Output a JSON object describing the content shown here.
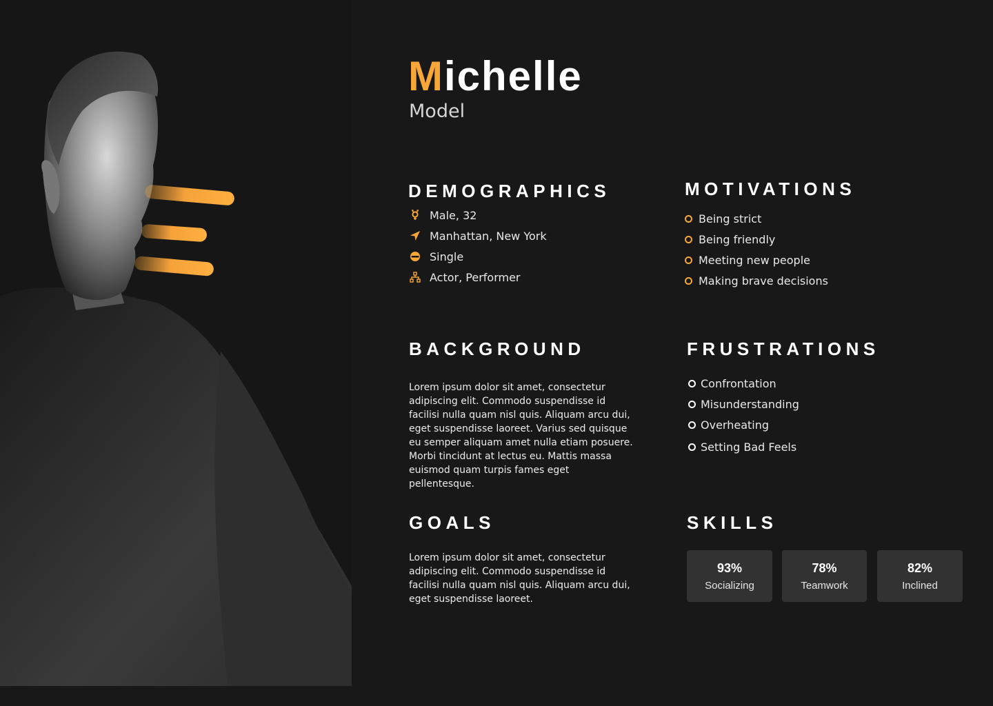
{
  "persona": {
    "name_initial": "M",
    "name_rest": "ichelle",
    "role": "Model"
  },
  "colors": {
    "accent": "#f7a738",
    "background": "#181818",
    "card": "#323232"
  },
  "demographics": {
    "title": "DEMOGRAPHICS",
    "items": [
      {
        "icon": "gender-icon",
        "text": "Male, 32"
      },
      {
        "icon": "location-arrow-icon",
        "text": "Manhattan, New York"
      },
      {
        "icon": "ring-icon",
        "text": "Single"
      },
      {
        "icon": "sitemap-icon",
        "text": "Actor, Performer"
      }
    ]
  },
  "motivations": {
    "title": "MOTIVATIONS",
    "items": [
      "Being strict",
      "Being friendly",
      "Meeting new people",
      "Making brave decisions"
    ]
  },
  "background": {
    "title": "BACKGROUND",
    "text": "Lorem ipsum dolor sit amet, consectetur adipiscing elit. Commodo suspendisse id facilisi nulla quam nisl quis. Aliquam arcu dui, eget suspendisse laoreet. Varius sed quisque eu semper aliquam amet nulla etiam posuere. Morbi tincidunt at lectus eu. Mattis massa euismod quam turpis fames eget pellentesque."
  },
  "frustrations": {
    "title": "FRUSTRATIONS",
    "items": [
      "Confrontation",
      "Misunderstanding",
      "Overheating",
      "Setting Bad Feels"
    ]
  },
  "goals": {
    "title": "GOALS",
    "text": "Lorem ipsum dolor sit amet, consectetur adipiscing elit. Commodo suspendisse id facilisi nulla quam nisl quis. Aliquam arcu dui, eget suspendisse laoreet."
  },
  "skills": {
    "title": "SKILLS",
    "items": [
      {
        "percent": "93%",
        "label": "Socializing"
      },
      {
        "percent": "78%",
        "label": "Teamwork"
      },
      {
        "percent": "82%",
        "label": "Inclined"
      }
    ]
  }
}
